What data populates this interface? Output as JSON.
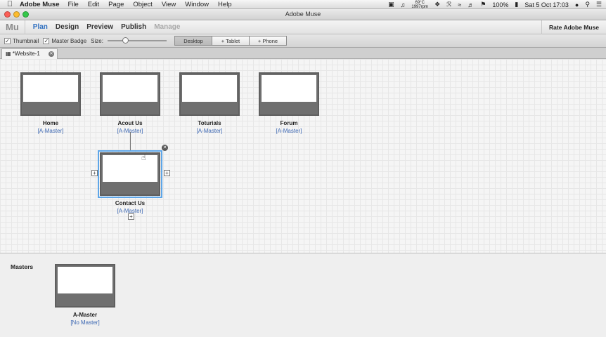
{
  "menubar": {
    "apple": "",
    "app_name": "Adobe Muse",
    "items": [
      "File",
      "Edit",
      "Page",
      "Object",
      "View",
      "Window",
      "Help"
    ],
    "temp": "69°C",
    "rpm": "1997rpm",
    "battery": "100%",
    "clock": "Sat 5 Oct  17:03"
  },
  "window": {
    "title": "Adobe Muse"
  },
  "app": {
    "logo": "Mu",
    "tabs": [
      "Plan",
      "Design",
      "Preview",
      "Publish",
      "Manage"
    ],
    "active_tab": "Plan",
    "rate": "Rate Adobe Muse"
  },
  "toolbar": {
    "thumbnail": "Thumbnail",
    "master_badge": "Master Badge",
    "size": "Size:",
    "views": [
      "Desktop",
      "+ Tablet",
      "+ Phone"
    ],
    "active_view": "Desktop"
  },
  "doc": {
    "tab": "*Website-1"
  },
  "pages": [
    {
      "name": "Home",
      "master": "[A-Master]"
    },
    {
      "name": "Acout Us",
      "master": "[A-Master]"
    },
    {
      "name": "Toturials",
      "master": "[A-Master]"
    },
    {
      "name": "Forum",
      "master": "[A-Master]"
    },
    {
      "name": "Contact Us",
      "master": "[A-Master]"
    }
  ],
  "masters": {
    "label": "Masters",
    "items": [
      {
        "name": "A-Master",
        "master": "[No Master]"
      }
    ]
  },
  "colors": {
    "accent": "#2e6fc0",
    "link": "#3d68b3",
    "selection": "#5ea6e8"
  }
}
